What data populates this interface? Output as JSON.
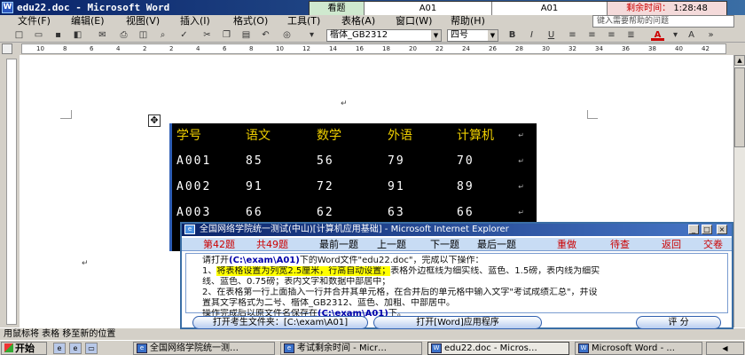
{
  "window": {
    "title": "edu22.doc - Microsoft Word",
    "app_icon": "word-icon"
  },
  "exam_strip": {
    "label": "看题",
    "current1": "A01",
    "current2": "A01",
    "remaining_label": "剩余时间：",
    "remaining_time": "1:28:48",
    "colors": {
      "label_bg": "#cfe9cf",
      "time_color": "#cc0000"
    }
  },
  "menu": {
    "items": [
      "文件(F)",
      "编辑(E)",
      "视图(V)",
      "插入(I)",
      "格式(O)",
      "工具(T)",
      "表格(A)",
      "窗口(W)",
      "帮助(H)"
    ],
    "help_placeholder": "键入需要帮助的问题"
  },
  "toolbar": {
    "font_name": "楷体_GB2312",
    "font_size": "四号",
    "bold": "B",
    "italic": "I",
    "underline": "U",
    "font_color_label": "A"
  },
  "ruler": {
    "ticks": [
      "10",
      "8",
      "6",
      "4",
      "2",
      "2",
      "4",
      "6",
      "8",
      "10",
      "12",
      "14",
      "16",
      "18",
      "20",
      "22",
      "24",
      "26",
      "28",
      "30",
      "32",
      "34",
      "36",
      "38",
      "40",
      "42"
    ]
  },
  "table": {
    "headers": [
      "学号",
      "语文",
      "数学",
      "外语",
      "计算机"
    ],
    "rows": [
      [
        "A001",
        "85",
        "56",
        "79",
        "70"
      ],
      [
        "A002",
        "91",
        "72",
        "91",
        "89"
      ],
      [
        "A003",
        "66",
        "62",
        "63",
        "66"
      ],
      [
        "",
        "",
        "",
        "",
        ""
      ]
    ],
    "colors": {
      "bg": "#000000",
      "header_text": "#f0d000",
      "cell_text": "#ffffff"
    },
    "mark": "↵"
  },
  "status_bar": {
    "text": "用鼠标将 表格 移至新的位置"
  },
  "taskbar": {
    "start_label": "开始",
    "tasks": [
      {
        "label": "全国网络学院统一测…"
      },
      {
        "label": "考试剩余时间 - Micr…"
      },
      {
        "label": "edu22.doc - Micros…"
      },
      {
        "label": "Microsoft Word - ..."
      }
    ]
  },
  "dialog": {
    "title": "全国网络学院统一测试(中山)[计算机应用基础] - Microsoft Internet Explorer",
    "nav": {
      "question_no": "第42题",
      "total": "共49题",
      "first": "最前一题",
      "prev": "上一题",
      "next": "下一题",
      "last": "最后一题",
      "redo": "重做",
      "pending": "待查",
      "back": "返回",
      "submit": "交卷"
    },
    "instructions": {
      "l1_a": "请打开",
      "l1_path": "(C:\\exam\\A01)",
      "l1_b": "下的Word文件\"edu22.doc\"，完成以下操作：",
      "l2_a": "1、",
      "l2_hl": "将表格设置为列宽2.5厘米，行高自动设置；",
      "l2_b": "表格外边框线为细实线、蓝色、1.5磅，表内线为细实",
      "l3": "线、蓝色、0.75磅；表内文字和数据中部居中；",
      "l4": "2、在表格第一行上面插入一行并合并其单元格，在合并后的单元格中输入文字\"考试成绩汇总\"，并设",
      "l5": "置其文字格式为二号、楷体_GB2312、蓝色、加粗、中部居中。",
      "l6_a": "操作完成后以原文件名保存在",
      "l6_path": "(C:\\exam\\A01)",
      "l6_b": "下。"
    },
    "footer": {
      "open_folder": "打开考生文件夹：[C:\\exam\\A01]",
      "open_app": "打开[Word]应用程序",
      "score": "评 分"
    }
  }
}
